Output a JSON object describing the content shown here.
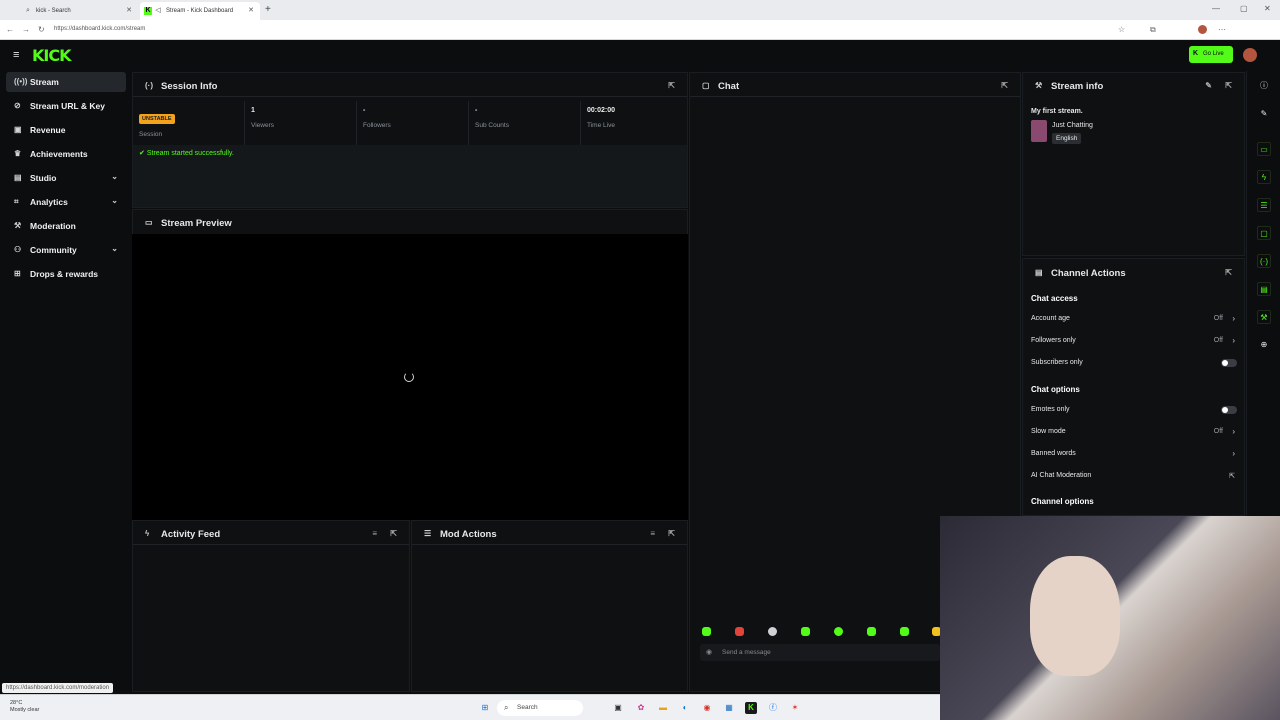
{
  "browser": {
    "tabs": [
      {
        "label": "kick - Search"
      },
      {
        "label": "Stream - Kick Dashboard"
      }
    ],
    "url": "https://dashboard.kick.com/stream"
  },
  "header": {
    "logo": "KICK",
    "go_live": "Go Live"
  },
  "sidebar": {
    "items": [
      {
        "label": "Stream",
        "icon": "broadcast-icon"
      },
      {
        "label": "Stream URL & Key",
        "icon": "link-icon"
      },
      {
        "label": "Revenue",
        "icon": "money-icon"
      },
      {
        "label": "Achievements",
        "icon": "trophy-icon"
      },
      {
        "label": "Studio",
        "icon": "studio-icon"
      },
      {
        "label": "Analytics",
        "icon": "analytics-icon"
      },
      {
        "label": "Moderation",
        "icon": "hammer-icon"
      },
      {
        "label": "Community",
        "icon": "people-icon"
      },
      {
        "label": "Drops & rewards",
        "icon": "gift-icon"
      }
    ]
  },
  "session": {
    "title": "Session Info",
    "badge": "UNSTABLE",
    "session_label": "Session",
    "viewers_value": "1",
    "viewers_label": "Viewers",
    "followers_value": "-",
    "followers_label": "Followers",
    "subs_value": "-",
    "subs_label": "Sub Counts",
    "time_value": "00:02:00",
    "time_label": "Time Live",
    "message": "Stream started successfully."
  },
  "preview": {
    "title": "Stream Preview"
  },
  "activity": {
    "title": "Activity Feed"
  },
  "mod_actions": {
    "title": "Mod Actions"
  },
  "chat": {
    "title": "Chat",
    "placeholder": "Send a message"
  },
  "stream_info": {
    "title": "Stream info",
    "stream_title": "My first stream.",
    "category": "Just Chatting",
    "language": "English"
  },
  "channel_actions": {
    "title": "Channel Actions",
    "chat_access": "Chat access",
    "account_age": "Account age",
    "account_age_value": "Off",
    "followers_only": "Followers only",
    "followers_only_value": "Off",
    "subscribers_only": "Subscribers only",
    "chat_options": "Chat options",
    "emotes_only": "Emotes only",
    "slow_mode": "Slow mode",
    "slow_mode_value": "Off",
    "banned_words": "Banned words",
    "ai_moderation": "AI Chat Moderation",
    "channel_options": "Channel options"
  },
  "status_bar_url": "https://dashboard.kick.com/moderation",
  "taskbar": {
    "temp": "28°C",
    "weather": "Mostly clear",
    "search": "Search"
  },
  "colors": {
    "accent": "#53fc18",
    "warning": "#f3a21c",
    "background": "#0b0d0f"
  }
}
